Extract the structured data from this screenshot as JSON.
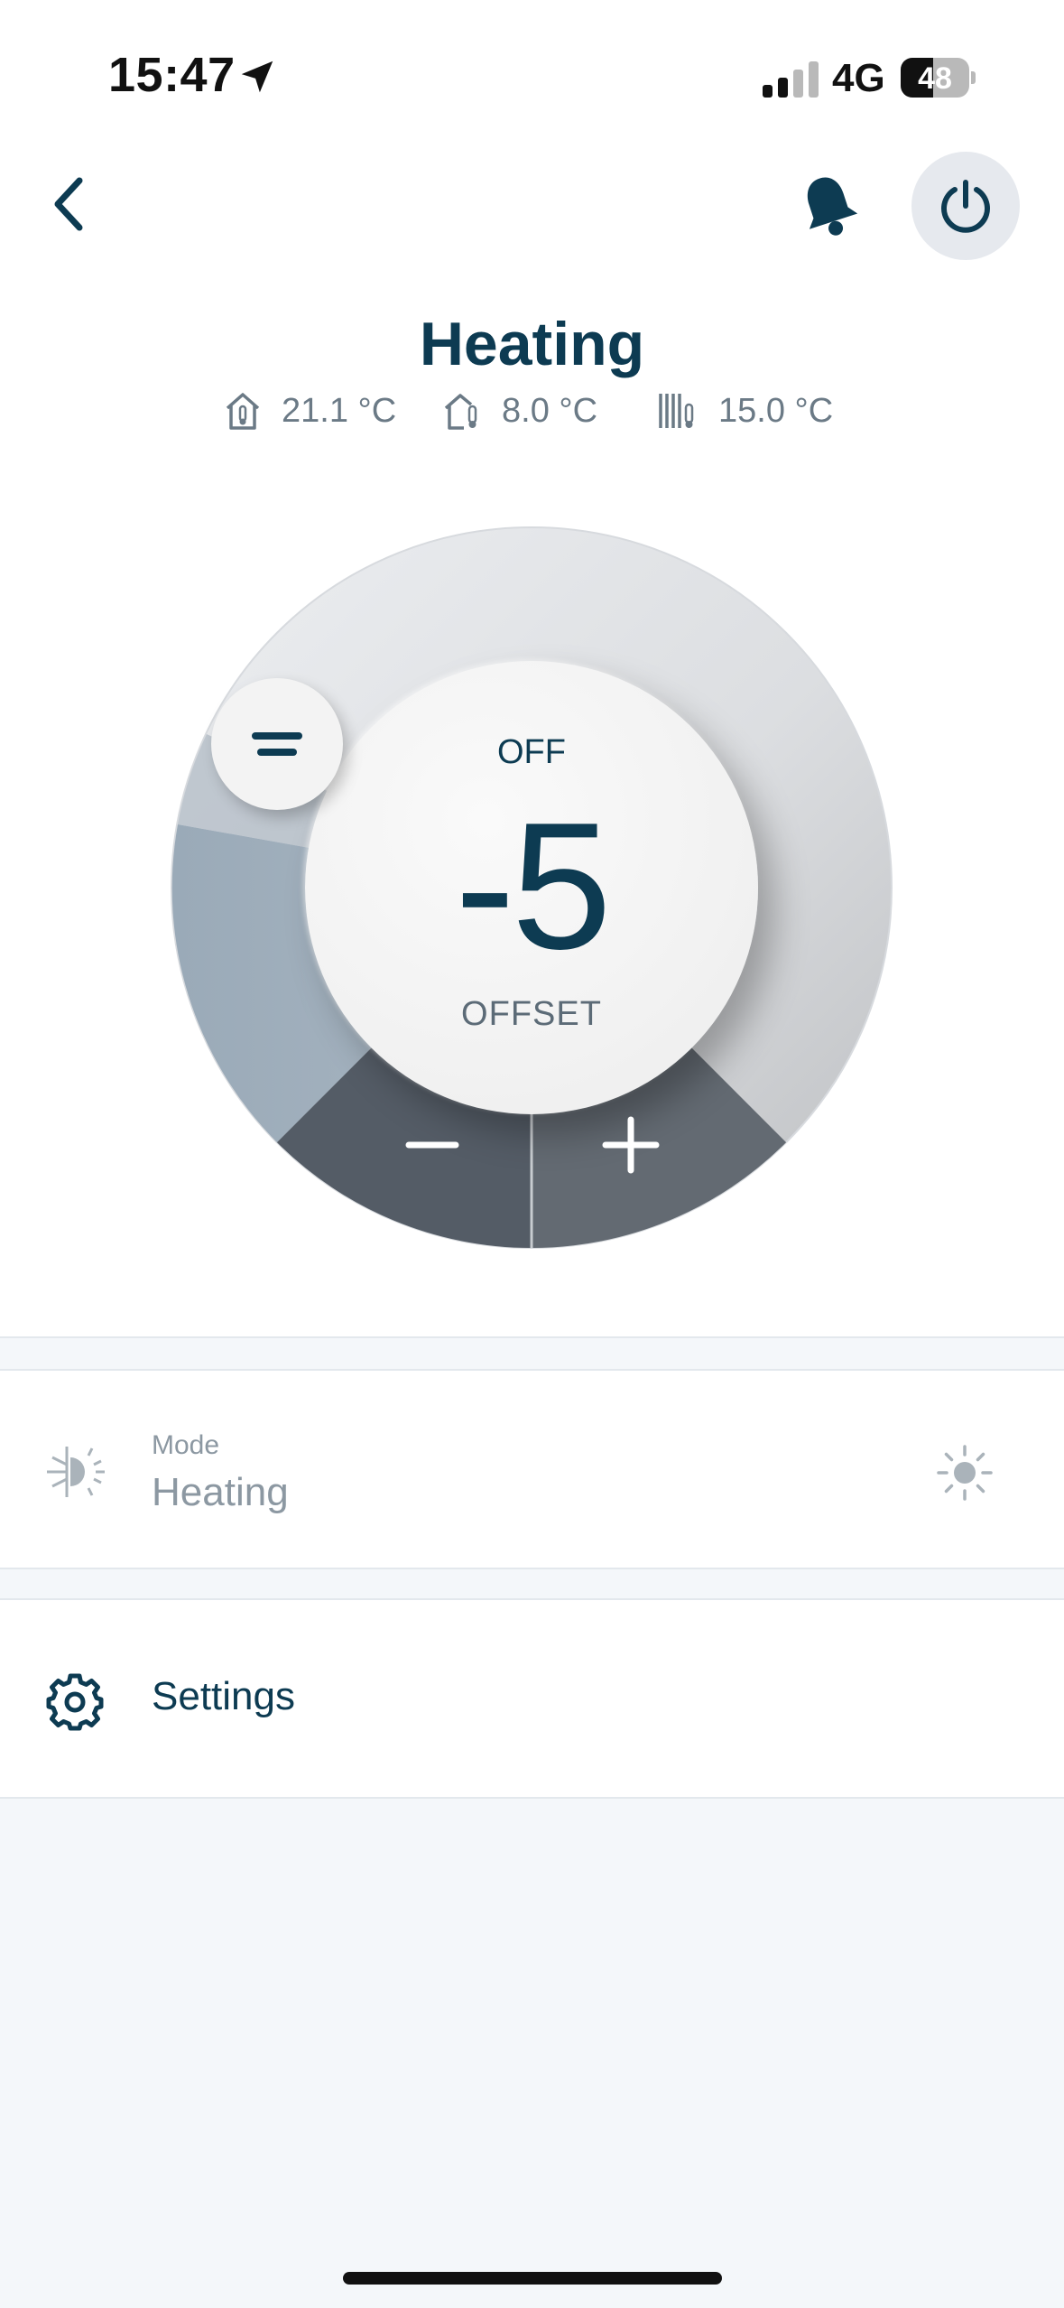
{
  "status_bar": {
    "time": "15:47",
    "network": "4G",
    "battery_level": "48",
    "battery_fraction": 0.48
  },
  "nav": {
    "back_icon": "chevron-left-icon",
    "bell_icon": "bell-icon",
    "power_icon": "power-icon"
  },
  "header": {
    "title": "Heating",
    "readings": [
      {
        "icon": "indoor-temperature-icon",
        "value": "21.1 °C"
      },
      {
        "icon": "outdoor-temperature-icon",
        "value": "8.0 °C"
      },
      {
        "icon": "radiator-temperature-icon",
        "value": "15.0 °C"
      }
    ]
  },
  "dial": {
    "state": "OFF",
    "value": "-5",
    "unit": "OFFSET",
    "minus_label": "−",
    "plus_label": "+"
  },
  "mode_row": {
    "label": "Mode",
    "value": "Heating",
    "left_icon": "heat-cool-mode-icon",
    "right_icon": "sun-icon"
  },
  "settings_row": {
    "label": "Settings",
    "icon": "gear-icon"
  },
  "colors": {
    "primary": "#0d3b52",
    "muted": "#8c98a2",
    "background": "#f4f7fa"
  }
}
